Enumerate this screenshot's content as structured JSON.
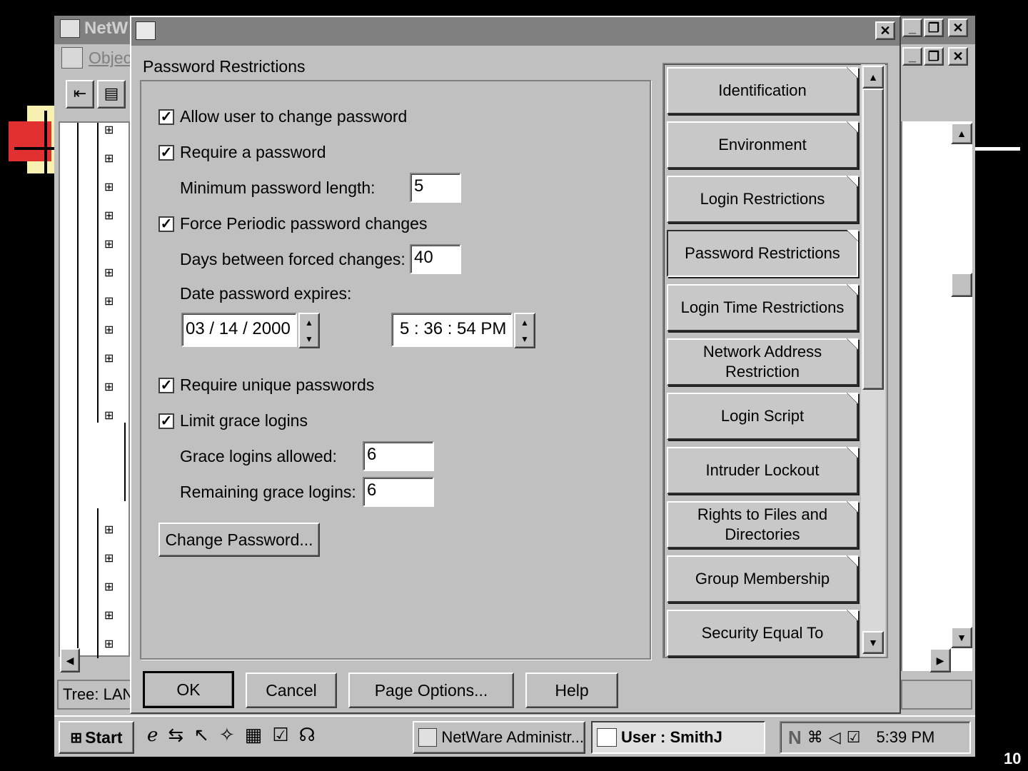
{
  "bg_window": {
    "title_fragment": "NetW",
    "menu_fragment": "Objec",
    "status_fragment": "Tree: LAN"
  },
  "dialog": {
    "section_title": "Password Restrictions",
    "allow_change": {
      "label": "Allow user to change password",
      "checked": true
    },
    "require_password": {
      "label": "Require a password",
      "checked": true
    },
    "min_length": {
      "label": "Minimum password length:",
      "value": "5"
    },
    "force_periodic": {
      "label": "Force Periodic password changes",
      "checked": true
    },
    "days_between": {
      "label": "Days between forced changes:",
      "value": "40"
    },
    "date_expires": {
      "label": "Date password expires:",
      "date": "03 / 14 / 2000",
      "time": "5 : 36 : 54 PM"
    },
    "require_unique": {
      "label": "Require unique passwords",
      "checked": true
    },
    "limit_grace": {
      "label": "Limit grace logins",
      "checked": true
    },
    "grace_allowed": {
      "label": "Grace logins allowed:",
      "value": "6"
    },
    "grace_remaining": {
      "label": "Remaining grace logins:",
      "value": "6"
    },
    "change_password_button": "Change Password...",
    "buttons": {
      "ok": "OK",
      "cancel": "Cancel",
      "page_options": "Page Options...",
      "help": "Help"
    },
    "tabs": [
      {
        "label": "Identification"
      },
      {
        "label": "Environment"
      },
      {
        "label": "Login Restrictions"
      },
      {
        "label": "Password Restrictions"
      },
      {
        "label": "Login Time Restrictions"
      },
      {
        "label": "Network Address Restriction"
      },
      {
        "label": "Login Script"
      },
      {
        "label": "Intruder Lockout"
      },
      {
        "label": "Rights to Files and Directories"
      },
      {
        "label": "Group Membership"
      },
      {
        "label": "Security Equal To"
      }
    ]
  },
  "taskbar": {
    "start": "Start",
    "task1": "NetWare Administr...",
    "task2": "User : SmithJ",
    "clock": "5:39 PM"
  },
  "slide_number": "10",
  "icons": {
    "check": "✓",
    "up": "▲",
    "down": "▼",
    "left": "◀",
    "right": "▶",
    "close": "✕",
    "minimize": "_",
    "restore": "❐"
  }
}
